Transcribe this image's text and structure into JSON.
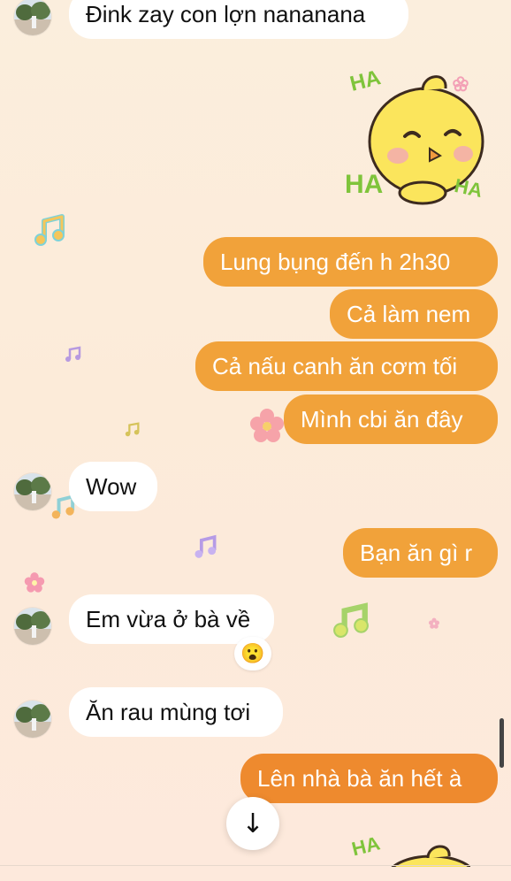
{
  "chat": {
    "messages": [
      {
        "id": "m0",
        "side": "incoming",
        "text": "Đink zay con lợn nananana"
      },
      {
        "id": "m1",
        "side": "outgoing",
        "text": "Lung bụng đến h 2h30"
      },
      {
        "id": "m2",
        "side": "outgoing",
        "text": "Cả làm nem"
      },
      {
        "id": "m3",
        "side": "outgoing",
        "text": "Cả nấu canh ăn cơm tối"
      },
      {
        "id": "m4",
        "side": "outgoing",
        "text": "Mình cbi ăn đây"
      },
      {
        "id": "m5",
        "side": "incoming",
        "text": "Wow"
      },
      {
        "id": "m6",
        "side": "outgoing",
        "text": "Bạn ăn gì r"
      },
      {
        "id": "m7",
        "side": "incoming",
        "text": "Em vừa ở bà về"
      },
      {
        "id": "m8",
        "side": "incoming",
        "text": "Ăn rau mùng tơi"
      },
      {
        "id": "m9",
        "side": "outgoing",
        "text": "Lên nhà bà ăn hết à"
      }
    ],
    "reaction": {
      "emoji": "😮"
    },
    "sticker": {
      "label_top": "HA",
      "label_left": "HA",
      "label_right": "HA",
      "label_bottom": "HA"
    },
    "scroll_button": {
      "icon": "arrow-down-icon",
      "glyph": "↓"
    }
  },
  "colors": {
    "outgoing": "#f1a23a",
    "outgoing_dark": "#ee8a2e",
    "incoming": "#ffffff",
    "background": "#fbeedd"
  }
}
